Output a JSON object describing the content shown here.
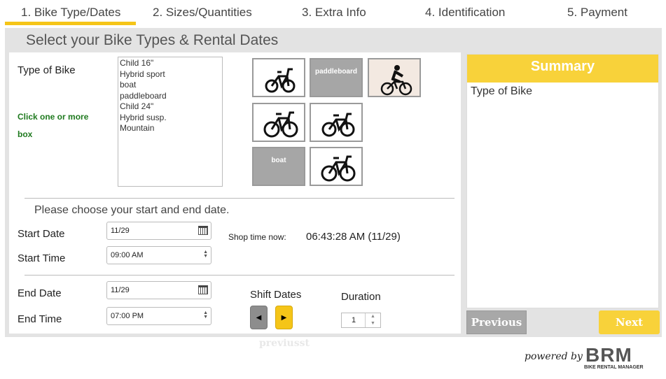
{
  "tabs": [
    {
      "label": "1. Bike Type/Dates",
      "active": true
    },
    {
      "label": "2. Sizes/Quantities"
    },
    {
      "label": "3. Extra Info"
    },
    {
      "label": "4. Identification"
    },
    {
      "label": "5. Payment"
    }
  ],
  "page_title": "Select your Bike Types & Rental Dates",
  "bike_type": {
    "label": "Type of Bike",
    "hint": "Click one or more box",
    "options": [
      "Child 16\"",
      "Hybrid sport",
      "boat",
      "paddleboard",
      "Child 24\"",
      "Hybrid susp.",
      "Mountain"
    ],
    "thumbs": [
      {
        "kind": "bike-icon"
      },
      {
        "kind": "text",
        "text": "paddleboard"
      },
      {
        "kind": "rider-icon"
      },
      {
        "kind": "bike-icon"
      },
      {
        "kind": "bike-icon"
      },
      {
        "kind": "text",
        "text": "boat"
      },
      {
        "kind": "bike-icon"
      }
    ]
  },
  "dates": {
    "prompt": "Please choose your start and end date.",
    "start_date_label": "Start Date",
    "start_date_value": "11/29",
    "start_time_label": "Start Time",
    "start_time_value": "09:00 AM",
    "end_date_label": "End Date",
    "end_date_value": "11/29",
    "end_time_label": "End Time",
    "end_time_value": "07:00 PM",
    "shop_time_label": "Shop time now:",
    "shop_time_value": "06:43:28 AM (11/29)",
    "shift_label": "Shift Dates",
    "shift_prev_glyph": "◀",
    "shift_next_glyph": "▶",
    "duration_label": "Duration",
    "duration_value": "1"
  },
  "summary": {
    "title": "Summary",
    "type_label": "Type of Bike"
  },
  "nav": {
    "previous": "Previous",
    "next": "Next",
    "ghost_text": "previusst"
  },
  "footer": {
    "powered_by": "powered by",
    "logo_letters": "BRM",
    "logo_sub": "BIKE RENTAL MANAGER"
  }
}
